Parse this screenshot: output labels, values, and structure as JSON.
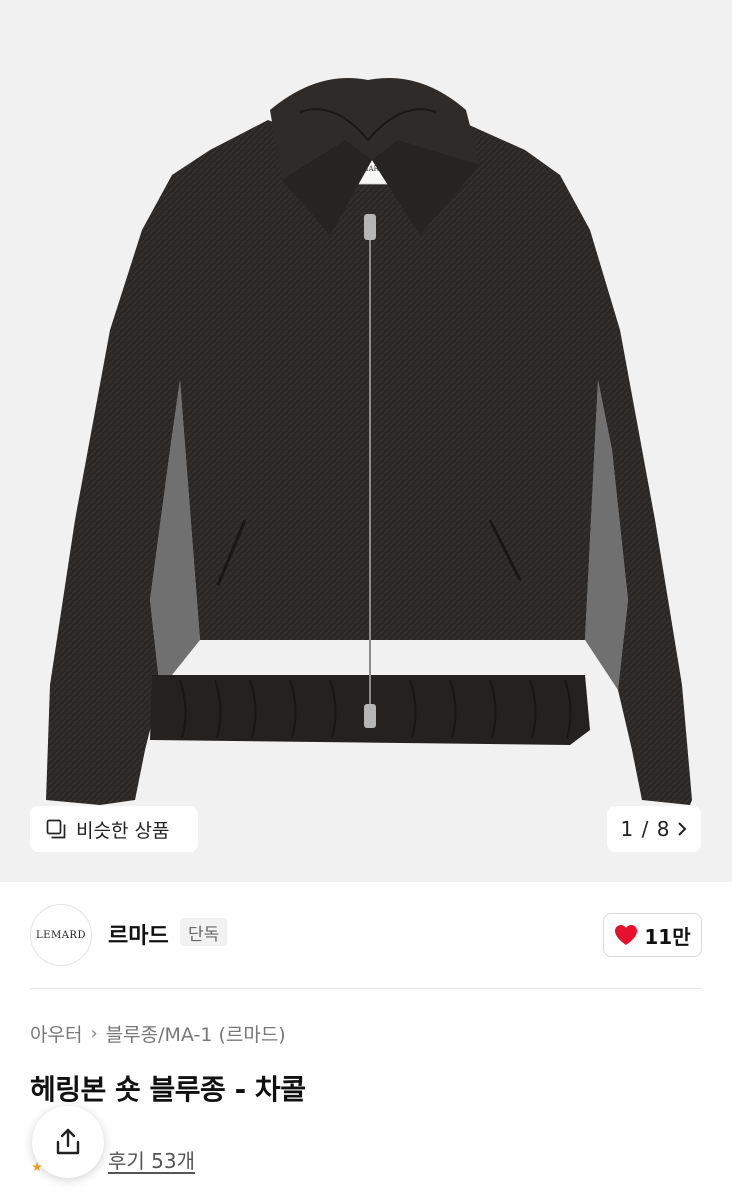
{
  "hero": {
    "similar_label": "비슷한 상품",
    "page_current": "1",
    "page_separator": "/",
    "page_total": "8",
    "image_brand_tag": "LEMARD"
  },
  "brand": {
    "logo_text": "LEMARD",
    "name": "르마드",
    "badge": "단독",
    "like_count": "11만"
  },
  "product": {
    "breadcrumb": [
      "아우터",
      "블루종/MA-1 (르마드)"
    ],
    "title": "헤링본 숏 블루종 - 차콜",
    "review_link": "후기 53개"
  },
  "colors": {
    "heart": "#e8112d",
    "rating_star": "#f5a623"
  },
  "icons": {
    "similar": "similar-products-icon",
    "next": "chevron-right-icon",
    "like": "heart-icon",
    "share": "share-icon"
  }
}
